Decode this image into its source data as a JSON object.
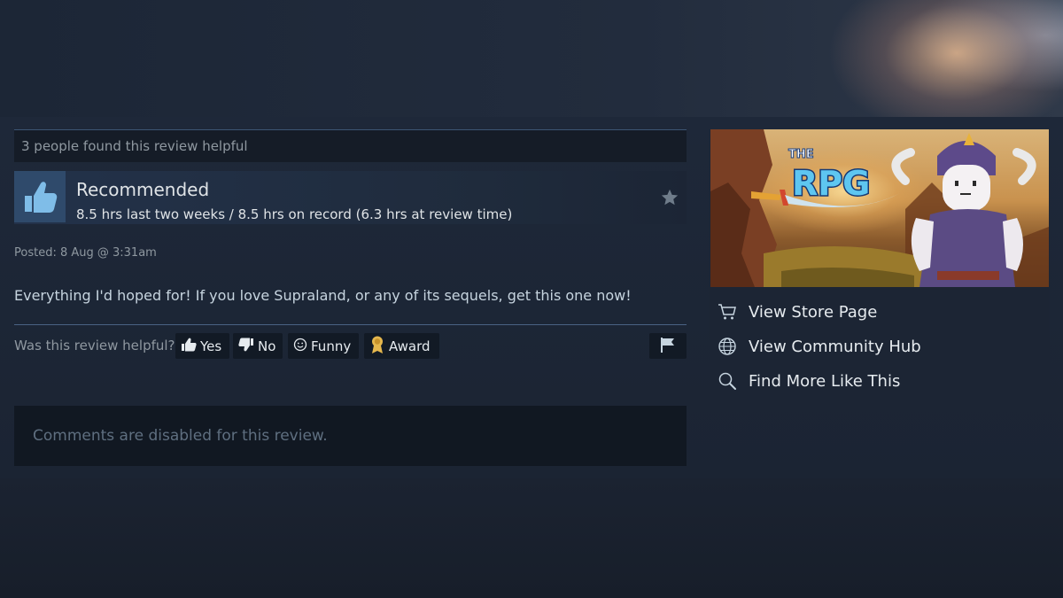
{
  "review": {
    "helpful_count_text": "3 people found this review helpful",
    "verdict": "Recommended",
    "hours": "8.5 hrs last two weeks / 8.5 hrs on record (6.3 hrs at review time)",
    "posted": "Posted: 8 Aug @ 3:31am",
    "text": "Everything I'd hoped for! If you love Supraland, or any of its sequels, get this one now!"
  },
  "vote": {
    "prompt": "Was this review helpful?",
    "yes_label": "Yes",
    "no_label": "No",
    "funny_label": "Funny",
    "award_label": "Award"
  },
  "comments": {
    "disabled_text": "Comments are disabled for this review."
  },
  "game": {
    "capsule_logo_text": "THE RPG"
  },
  "sidebar": {
    "links": [
      {
        "label": "View Store Page",
        "icon": "cart-icon"
      },
      {
        "label": "View Community Hub",
        "icon": "globe-icon"
      },
      {
        "label": "Find More Like This",
        "icon": "search-icon"
      }
    ]
  },
  "colors": {
    "accent_blue": "#66c0f4",
    "thumb_bg": "#2f4a6b",
    "award_gold": "#e5b74d"
  }
}
